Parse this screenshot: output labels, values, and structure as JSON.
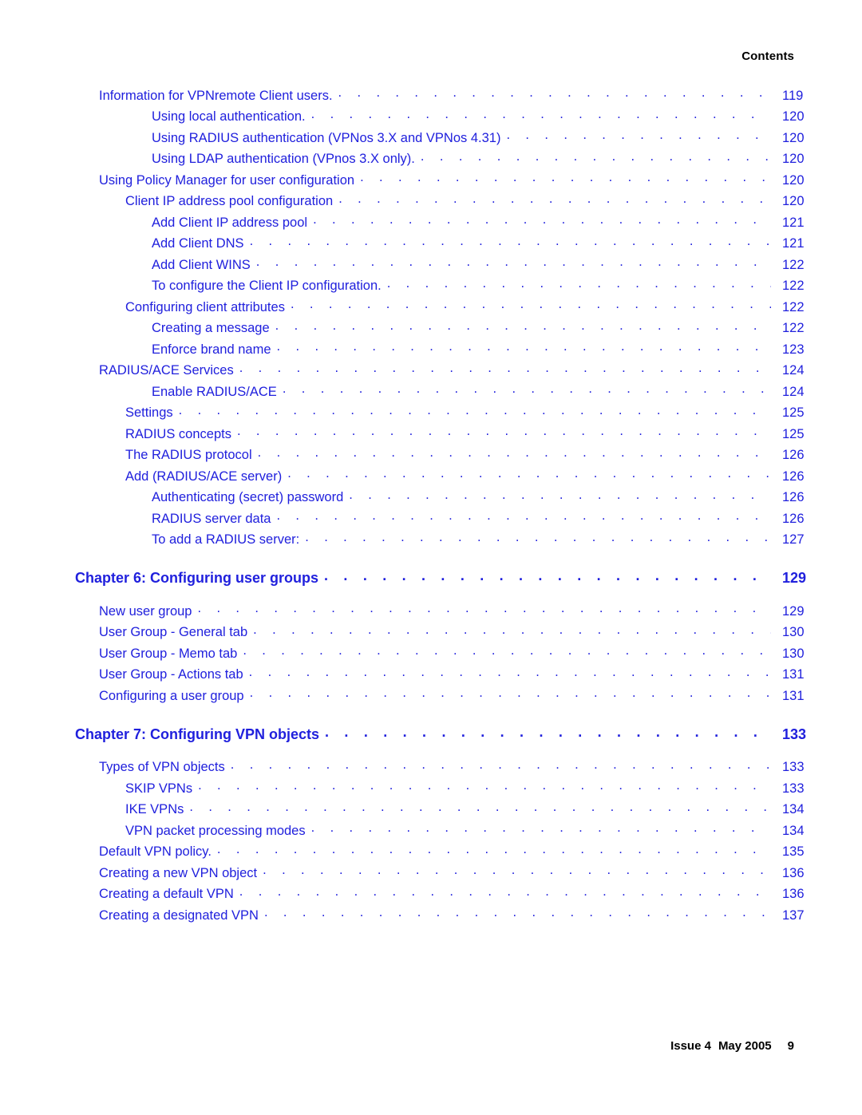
{
  "header": {
    "title": "Contents"
  },
  "footer": {
    "issue": "Issue 4",
    "date": "May 2005",
    "page_number": "9"
  },
  "colors": {
    "link_blue": "#2020dd",
    "text_black": "#000000",
    "background": "#ffffff"
  },
  "toc": {
    "entries": [
      {
        "level": 1,
        "label": "Information for VPNremote Client users.",
        "page": "119",
        "chapter": false
      },
      {
        "level": 3,
        "label": "Using local authentication.",
        "page": "120",
        "chapter": false
      },
      {
        "level": 3,
        "label": "Using RADIUS authentication (VPNos 3.X and VPNos 4.31)",
        "page": "120",
        "chapter": false
      },
      {
        "level": 3,
        "label": "Using LDAP authentication (VPnos 3.X only).",
        "page": "120",
        "chapter": false
      },
      {
        "level": 1,
        "label": "Using Policy Manager for user configuration",
        "page": "120",
        "chapter": false
      },
      {
        "level": 2,
        "label": "Client IP address pool configuration",
        "page": "120",
        "chapter": false
      },
      {
        "level": 3,
        "label": "Add Client IP address pool",
        "page": "121",
        "chapter": false
      },
      {
        "level": 3,
        "label": "Add Client DNS",
        "page": "121",
        "chapter": false
      },
      {
        "level": 3,
        "label": "Add Client WINS",
        "page": "122",
        "chapter": false
      },
      {
        "level": 3,
        "label": "To configure the Client IP configuration.",
        "page": "122",
        "chapter": false
      },
      {
        "level": 2,
        "label": "Configuring client attributes",
        "page": "122",
        "chapter": false
      },
      {
        "level": 3,
        "label": "Creating a message",
        "page": "122",
        "chapter": false
      },
      {
        "level": 3,
        "label": "Enforce brand name",
        "page": "123",
        "chapter": false
      },
      {
        "level": 1,
        "label": "RADIUS/ACE Services",
        "page": "124",
        "chapter": false
      },
      {
        "level": 3,
        "label": "Enable RADIUS/ACE",
        "page": "124",
        "chapter": false
      },
      {
        "level": 2,
        "label": "Settings",
        "page": "125",
        "chapter": false
      },
      {
        "level": 2,
        "label": "RADIUS concepts",
        "page": "125",
        "chapter": false
      },
      {
        "level": 2,
        "label": "The RADIUS protocol",
        "page": "126",
        "chapter": false
      },
      {
        "level": 2,
        "label": "Add (RADIUS/ACE server)",
        "page": "126",
        "chapter": false
      },
      {
        "level": 3,
        "label": "Authenticating (secret) password",
        "page": "126",
        "chapter": false
      },
      {
        "level": 3,
        "label": "RADIUS server data",
        "page": "126",
        "chapter": false
      },
      {
        "level": 3,
        "label": "To add a RADIUS server:",
        "page": "127",
        "chapter": false
      },
      {
        "level": 0,
        "label": "Chapter 6: Configuring user groups",
        "page": "129",
        "chapter": true
      },
      {
        "level": 1,
        "label": "New user group",
        "page": "129",
        "chapter": false
      },
      {
        "level": 1,
        "label": "User Group - General tab",
        "page": "130",
        "chapter": false
      },
      {
        "level": 1,
        "label": "User Group - Memo tab",
        "page": "130",
        "chapter": false
      },
      {
        "level": 1,
        "label": "User Group - Actions tab",
        "page": "131",
        "chapter": false
      },
      {
        "level": 1,
        "label": "Configuring a user group",
        "page": "131",
        "chapter": false
      },
      {
        "level": 0,
        "label": "Chapter 7: Configuring VPN objects",
        "page": "133",
        "chapter": true
      },
      {
        "level": 1,
        "label": "Types of VPN objects",
        "page": "133",
        "chapter": false
      },
      {
        "level": 2,
        "label": "SKIP VPNs",
        "page": "133",
        "chapter": false
      },
      {
        "level": 2,
        "label": "IKE VPNs",
        "page": "134",
        "chapter": false
      },
      {
        "level": 2,
        "label": "VPN packet processing modes",
        "page": "134",
        "chapter": false
      },
      {
        "level": 1,
        "label": "Default VPN policy.",
        "page": "135",
        "chapter": false
      },
      {
        "level": 1,
        "label": "Creating a new VPN object",
        "page": "136",
        "chapter": false
      },
      {
        "level": 1,
        "label": "Creating a default VPN",
        "page": "136",
        "chapter": false
      },
      {
        "level": 1,
        "label": "Creating a designated VPN",
        "page": "137",
        "chapter": false
      }
    ]
  }
}
